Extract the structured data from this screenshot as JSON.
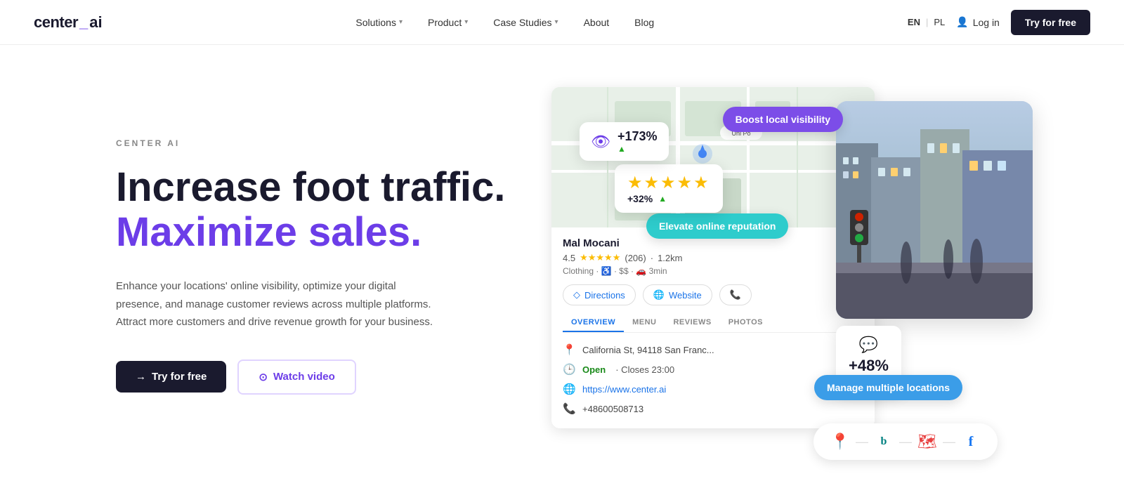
{
  "logo": {
    "text": "center_ai",
    "underscore": "_"
  },
  "nav": {
    "links": [
      {
        "label": "Solutions",
        "hasDropdown": true
      },
      {
        "label": "Product",
        "hasDropdown": true
      },
      {
        "label": "Case Studies",
        "hasDropdown": true
      },
      {
        "label": "About",
        "hasDropdown": false
      },
      {
        "label": "Blog",
        "hasDropdown": false
      }
    ],
    "lang": {
      "active": "EN",
      "secondary": "PL"
    },
    "login": "Log in",
    "try_free": "Try for free"
  },
  "hero": {
    "eyebrow": "CENTER AI",
    "headline_black": "Increase foot traffic.",
    "headline_purple": "Maximize sales.",
    "description": "Enhance your locations' online visibility, optimize your digital presence, and manage customer reviews across multiple platforms. Attract more customers and drive revenue growth for your business.",
    "btn_primary": "Try for free",
    "btn_primary_icon": "→",
    "btn_secondary": "Watch video",
    "btn_secondary_icon": "⊙"
  },
  "illustration": {
    "badges": {
      "visibility": "Boost local visibility",
      "reputation": "Elevate online reputation",
      "locations": "Manage multiple locations"
    },
    "stats": {
      "views": "+173%",
      "views_change": "↑",
      "rating_stars": "★★★★★",
      "rating_pct": "+32%",
      "rating_change": "↑",
      "engage_pct": "+48%",
      "engage_change": "↑"
    },
    "business": {
      "name": "Mal Mocani",
      "rating": "4.5",
      "reviews": "(206)",
      "distance": "1.2km",
      "category": "Clothing · ♿ · $$ · 🚗 3min",
      "address": "California St, 94118 San Franc...",
      "hours": "Open · Closes 23:00",
      "website": "https://www.center.ai",
      "phone": "+48600508713",
      "tabs": [
        "OVERVIEW",
        "MENU",
        "REVIEWS",
        "PHOTOS"
      ]
    },
    "platforms": [
      "📍",
      "Ⓑ",
      "🗺",
      "f"
    ]
  }
}
